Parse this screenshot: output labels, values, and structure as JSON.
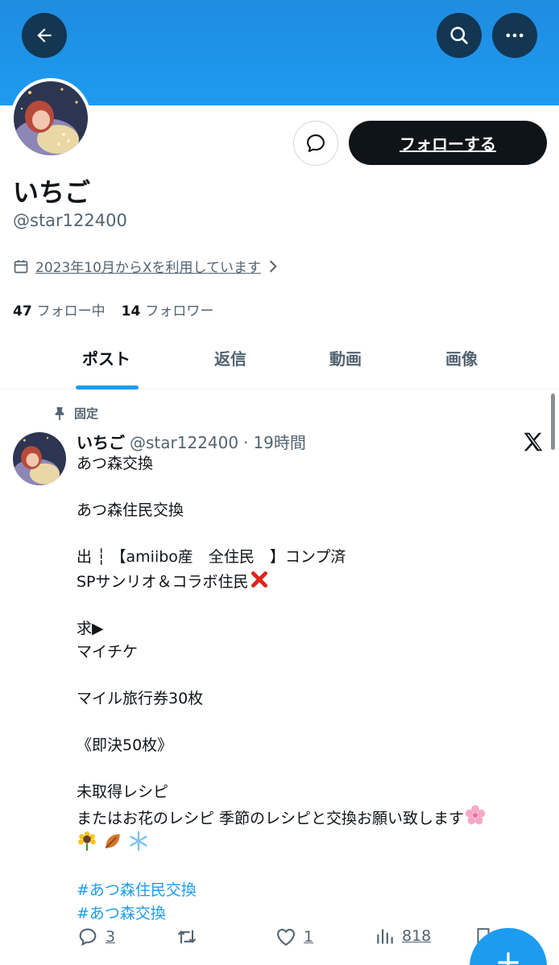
{
  "profile": {
    "display_name": "いちご",
    "handle": "@star122400",
    "joined_text": "2023年10月からXを利用しています",
    "following_count": "47",
    "following_label": "フォロー中",
    "followers_count": "14",
    "followers_label": "フォロワー",
    "follow_button_label": "フォローする"
  },
  "tabs": [
    "ポスト",
    "返信",
    "動画",
    "画像"
  ],
  "active_tab": "ポスト",
  "post": {
    "pinned_label": "固定",
    "author_name": "いちご",
    "author_handle": "@star122400",
    "time_separator": "·",
    "time_ago": "19時間",
    "lines": [
      "あつ森交換",
      "",
      "あつ森住民交換",
      "",
      "出 ┆ 【amiibo産　全住民　】コンプ済",
      "SPサンリオ＆コラボ住民",
      "",
      "求▶︎",
      "マイチケ",
      "",
      "マイル旅行券30枚",
      "",
      "《即決50枚》",
      "",
      "未取得レシピ",
      "またはお花のレシピ 季節のレシピと交換お願い致します"
    ],
    "hashtags": [
      "#あつ森住民交換",
      "#あつ森交換"
    ],
    "stats": {
      "replies": "3",
      "reposts": "",
      "likes": "1",
      "views": "818"
    }
  },
  "colors": {
    "accent": "#1d9bf0",
    "text_primary": "#0f1419",
    "text_secondary": "#536471",
    "button_dark": "#0f1419"
  },
  "icons": {
    "back": "arrow-left-icon",
    "search": "search-icon",
    "more": "more-icon",
    "message": "message-bubble-icon",
    "calendar": "calendar-icon",
    "pin": "pin-icon",
    "x_logo": "x-logo-icon",
    "reply": "reply-icon",
    "repost": "repost-icon",
    "like": "heart-icon",
    "views": "views-icon",
    "compose": "plus-icon"
  }
}
